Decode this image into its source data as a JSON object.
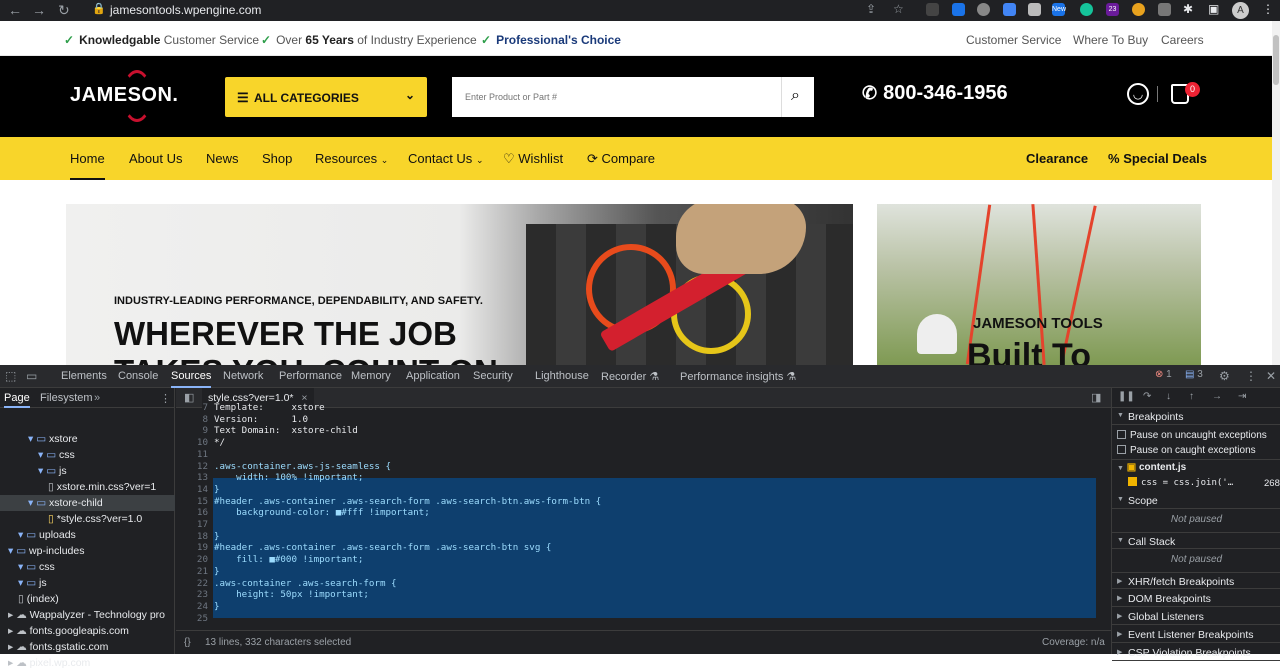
{
  "browser": {
    "url": "jamesontools.wpengine.com",
    "profile_initial": "A",
    "ext_badges": [
      "New",
      "23"
    ]
  },
  "site": {
    "topbar": {
      "items": [
        {
          "bold": "Knowledgable",
          "text": " Customer Service"
        },
        {
          "pre": "Over ",
          "bold": "65 Years",
          "text": " of Industry Experience"
        },
        {
          "bold": "Professional's Choice",
          "text": ""
        }
      ],
      "links": [
        "Customer Service",
        "Where To Buy",
        "Careers"
      ]
    },
    "header": {
      "logo": "JAMESON.",
      "all_categories": "ALL CATEGORIES",
      "search_placeholder": "Enter Product or Part #",
      "phone": "800-346-1956",
      "cart_count": "0"
    },
    "nav": {
      "items": [
        "Home",
        "About Us",
        "News",
        "Shop",
        "Resources",
        "Contact Us",
        "Wishlist",
        "Compare"
      ],
      "right": [
        "Clearance",
        "Special Deals"
      ]
    },
    "hero": {
      "kicker": "INDUSTRY-LEADING PERFORMANCE, DEPENDABILITY, AND SAFETY.",
      "headline_1": "WHEREVER THE JOB",
      "headline_2": "TAKES YOU, COUNT ON"
    },
    "side_banner": {
      "title": "JAMESON TOOLS",
      "headline": "Built To"
    }
  },
  "devtools": {
    "tabs": [
      "Elements",
      "Console",
      "Sources",
      "Network",
      "Performance",
      "Memory",
      "Application",
      "Security",
      "Lighthouse",
      "Recorder",
      "Performance insights"
    ],
    "errors": "1",
    "messages": "3",
    "left_tabs": [
      "Page",
      "Filesystem"
    ],
    "tree": [
      {
        "label": "xstore",
        "type": "folder",
        "indent": 2
      },
      {
        "label": "css",
        "type": "folder",
        "indent": 3
      },
      {
        "label": "js",
        "type": "folder",
        "indent": 3
      },
      {
        "label": "xstore.min.css?ver=1",
        "type": "file",
        "indent": 4
      },
      {
        "label": "xstore-child",
        "type": "folder",
        "indent": 2
      },
      {
        "label": "*style.css?ver=1.0",
        "type": "file",
        "indent": 4
      },
      {
        "label": "uploads",
        "type": "folder",
        "indent": 1
      },
      {
        "label": "wp-includes",
        "type": "folder",
        "indent": 0
      },
      {
        "label": "css",
        "type": "folder",
        "indent": 1
      },
      {
        "label": "js",
        "type": "folder",
        "indent": 1
      },
      {
        "label": "(index)",
        "type": "file",
        "indent": 1
      },
      {
        "label": "Wappalyzer - Technology pro",
        "type": "cloud",
        "indent": -1
      },
      {
        "label": "fonts.googleapis.com",
        "type": "cloud",
        "indent": -1
      },
      {
        "label": "fonts.gstatic.com",
        "type": "cloud",
        "indent": -1
      },
      {
        "label": "pixel.wp.com",
        "type": "cloud",
        "indent": -1
      }
    ],
    "editor_tab": "style.css?ver=1.0*",
    "code": [
      {
        "n": "7",
        "t": "Template:     xstore"
      },
      {
        "n": "8",
        "t": "Version:      1.0"
      },
      {
        "n": "9",
        "t": "Text Domain:  xstore-child"
      },
      {
        "n": "10",
        "t": "*/"
      },
      {
        "n": "11",
        "t": ""
      },
      {
        "n": "12",
        "t": ".aws-container.aws-js-seamless {"
      },
      {
        "n": "13",
        "t": "    width: 100% !important;"
      },
      {
        "n": "14",
        "t": "}"
      },
      {
        "n": "15",
        "t": "#header .aws-container .aws-search-form .aws-search-btn.aws-form-btn {"
      },
      {
        "n": "16",
        "t": "    background-color: ■#fff !important;"
      },
      {
        "n": "17",
        "t": ""
      },
      {
        "n": "18",
        "t": "}"
      },
      {
        "n": "19",
        "t": "#header .aws-container .aws-search-form .aws-search-btn svg {"
      },
      {
        "n": "20",
        "t": "    fill: ■#000 !important;"
      },
      {
        "n": "21",
        "t": "}"
      },
      {
        "n": "22",
        "t": ".aws-container .aws-search-form {"
      },
      {
        "n": "23",
        "t": "    height: 50px !important;"
      },
      {
        "n": "24",
        "t": "}"
      },
      {
        "n": "25",
        "t": ""
      }
    ],
    "status_left": "13 lines, 332 characters selected",
    "status_right": "Coverage: n/a",
    "right": {
      "breakpoints": "Breakpoints",
      "pause_uncaught": "Pause on uncaught exceptions",
      "pause_caught": "Pause on caught exceptions",
      "file": "content.js",
      "bp_code": "css = css.join('…",
      "bp_line": "268",
      "scope": "Scope",
      "not_paused": "Not paused",
      "call_stack": "Call Stack",
      "xhr": "XHR/fetch Breakpoints",
      "dom": "DOM Breakpoints",
      "global": "Global Listeners",
      "event": "Event Listener Breakpoints",
      "csp": "CSP Violation Breakpoints"
    }
  }
}
